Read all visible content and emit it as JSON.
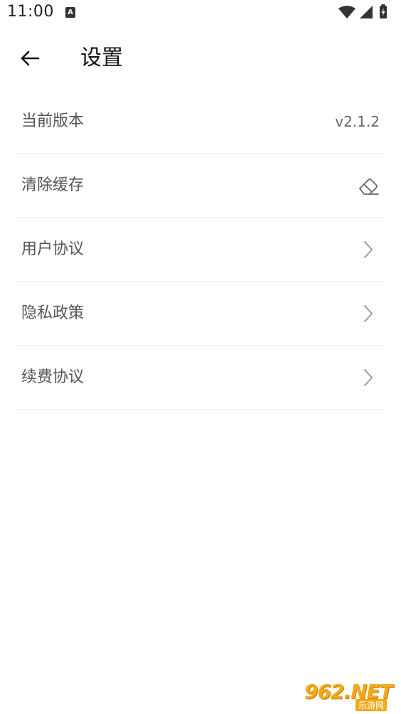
{
  "status_bar": {
    "time": "11:00",
    "notification_glyph": "A",
    "icons": [
      "wifi-icon",
      "signal-icon",
      "battery-charging-icon"
    ]
  },
  "toolbar": {
    "back_icon": "arrow-left-icon",
    "title": "设置"
  },
  "settings": {
    "items": [
      {
        "label": "当前版本",
        "value": "v2.1.2"
      },
      {
        "label": "清除缓存",
        "icon": "eraser-icon"
      },
      {
        "label": "用户协议",
        "icon": "chevron-right-icon"
      },
      {
        "label": "隐私政策",
        "icon": "chevron-right-icon"
      },
      {
        "label": "续费协议",
        "icon": "chevron-right-icon"
      }
    ]
  },
  "watermark": {
    "text": "962.NET",
    "sub": "乐游网"
  },
  "colors": {
    "label": "#555555",
    "divider": "#ececec",
    "watermark": "#f2a91a"
  }
}
